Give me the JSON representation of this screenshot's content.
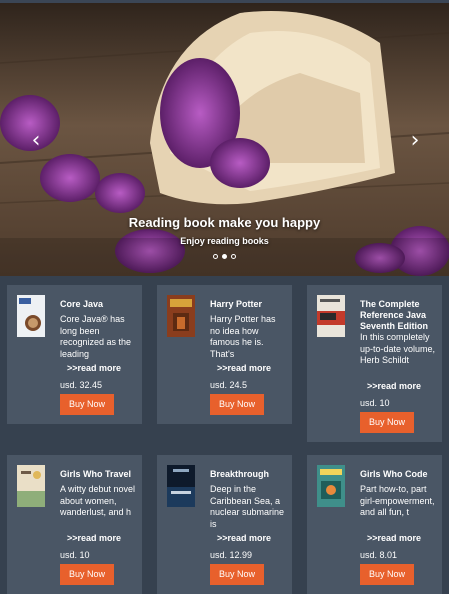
{
  "carousel": {
    "title": "Reading book make you happy",
    "subtitle": "Enjoy reading books",
    "prev_icon": "‹",
    "next_icon": "›",
    "slide_count": 3,
    "active_slide": 2
  },
  "colors": {
    "page_background": "#36414f",
    "card_background": "#4a5665",
    "buy_button": "#e8602c"
  },
  "products": [
    {
      "title": "Core Java",
      "description": "Core Java® has long been recognized as the leading",
      "read_more": ">>read more",
      "price": "usd. 32.45",
      "buy_label": "Buy Now",
      "cover_icon": "java-book-cover-icon"
    },
    {
      "title": "Harry Potter",
      "description": "Harry Potter has no idea how famous he is. That's",
      "read_more": ">>read more",
      "price": "usd. 24.5",
      "buy_label": "Buy Now",
      "cover_icon": "harry-potter-cover-icon"
    },
    {
      "title": "The Complete Reference Java Seventh Edition",
      "description": "In this completely up-to-date volume, Herb Schildt",
      "read_more": ">>read more",
      "price": "usd. 10",
      "buy_label": "Buy Now",
      "cover_icon": "complete-reference-java-cover-icon"
    },
    {
      "title": "Girls Who Travel",
      "description": "A witty debut novel about women, wanderlust, and h",
      "read_more": ">>read more",
      "price": "usd. 10",
      "buy_label": "Buy Now",
      "cover_icon": "girls-who-travel-cover-icon"
    },
    {
      "title": "Breakthrough",
      "description": "Deep in the Caribbean Sea, a nuclear submarine is",
      "read_more": ">>read more",
      "price": "usd. 12.99",
      "buy_label": "Buy Now",
      "cover_icon": "breakthrough-cover-icon"
    },
    {
      "title": "Girls Who Code",
      "description": "Part how-to, part girl-empowerment, and all fun, t",
      "read_more": ">>read more",
      "price": "usd. 8.01",
      "buy_label": "Buy Now",
      "cover_icon": "girls-who-code-cover-icon"
    }
  ]
}
